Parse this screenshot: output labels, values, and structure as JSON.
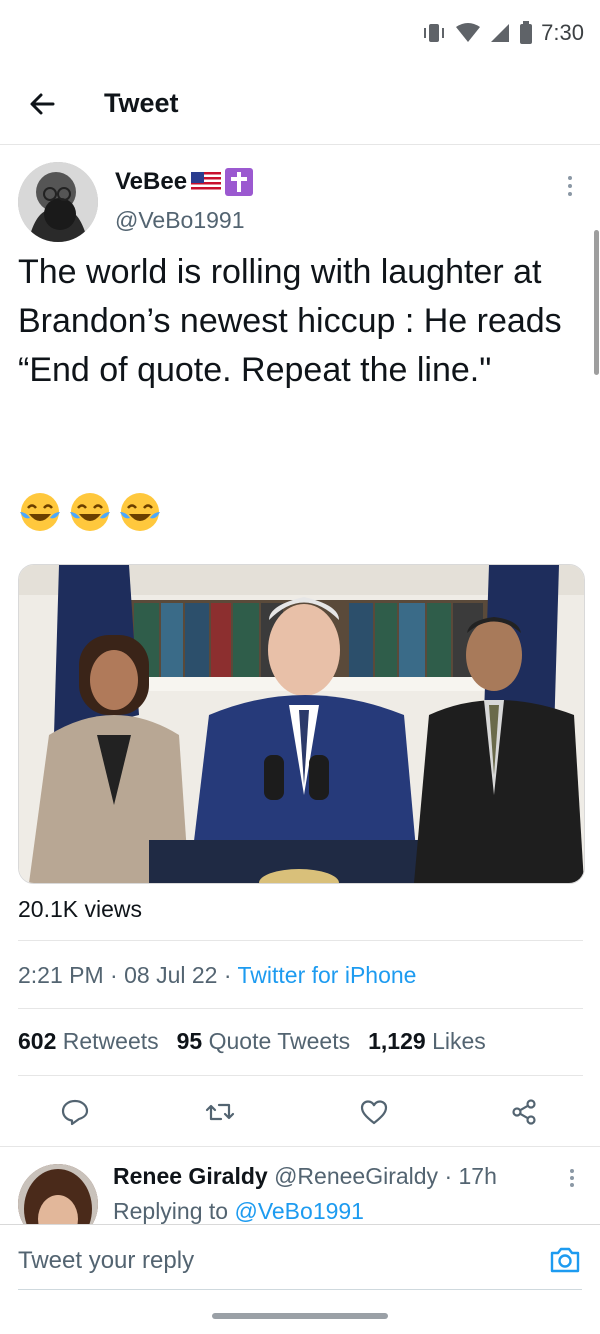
{
  "status_bar": {
    "time": "7:30"
  },
  "header": {
    "title": "Tweet"
  },
  "tweet": {
    "author_name": "VeBee",
    "author_handle": "@VeBo1991",
    "text": "The world is rolling with laughter at Brandon’s newest hiccup : He reads “End of quote. Repeat the line.\"",
    "emojis": [
      "😂",
      "😂",
      "😂"
    ],
    "views": "20.1K views",
    "time": "2:21 PM",
    "date": "08 Jul 22",
    "source": "Twitter for iPhone",
    "retweets_count": "602",
    "retweets_label": "Retweets",
    "quotes_count": "95",
    "quotes_label": "Quote Tweets",
    "likes_count": "1,129",
    "likes_label": "Likes"
  },
  "reply": {
    "name": "Renee Giraldy",
    "handle": "@ReneeGiraldy",
    "time": "17h",
    "replying_label": "Replying to",
    "replying_to": "@VeBo1991"
  },
  "composer": {
    "placeholder": "Tweet your reply"
  },
  "colors": {
    "accent": "#1d9bf0",
    "text": "#0f1419",
    "secondary": "#536471",
    "cross_badge": "#9b59d0"
  }
}
